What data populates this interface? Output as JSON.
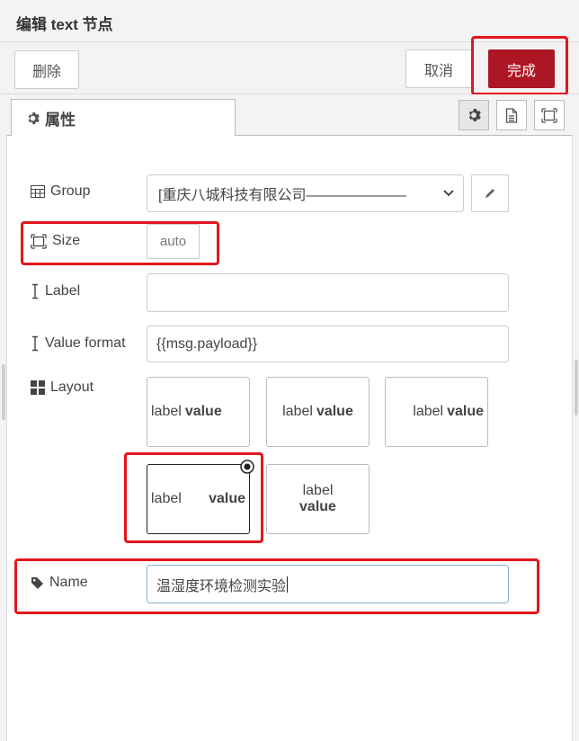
{
  "header": {
    "title": "编辑 text 节点"
  },
  "toolbar": {
    "delete_label": "删除",
    "cancel_label": "取消",
    "done_label": "完成"
  },
  "tabs": {
    "properties_label": "属性"
  },
  "form": {
    "group": {
      "label": "Group",
      "value": "[重庆八城科技有限公司———————"
    },
    "size": {
      "label": "Size",
      "value": "auto"
    },
    "label_field": {
      "label": "Label",
      "value": ""
    },
    "value_format": {
      "label": "Value format",
      "value": "{{msg.payload}}"
    },
    "layout": {
      "label": "Layout",
      "options": [
        {
          "label_text": "label",
          "value_text": "value",
          "selected": false
        },
        {
          "label_text": "label",
          "value_text": "value",
          "selected": false
        },
        {
          "label_text": "label",
          "value_text": "value",
          "selected": false
        },
        {
          "label_text": "label",
          "value_text": "value",
          "selected": true
        },
        {
          "label_text": "label",
          "value_text": "value",
          "selected": false
        }
      ]
    },
    "name": {
      "label": "Name",
      "value": "温湿度环境检测实验"
    }
  },
  "colors": {
    "primary": "#ad1625",
    "highlight": "#e3161e",
    "toolbar_bg": "#f3f3f3"
  }
}
